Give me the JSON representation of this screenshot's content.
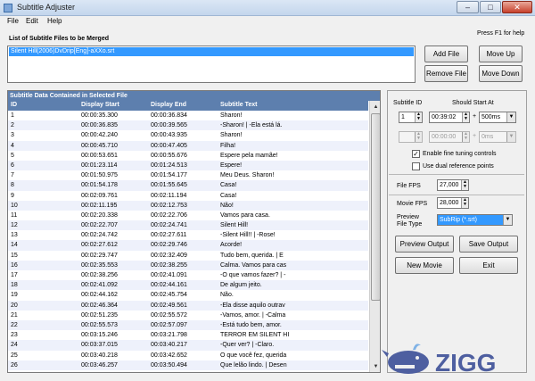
{
  "window": {
    "title": "Subtitle Adjuster",
    "minimize": "–",
    "maximize": "□",
    "close": "✕"
  },
  "menu": [
    "File",
    "Edit",
    "Help"
  ],
  "files": {
    "label": "List of Subtitle Files to be Merged",
    "help_hint": "Press F1 for help",
    "items": [
      "Silent Hill(2006)DvDrip[Eng]-aXXo.srt"
    ]
  },
  "buttons": {
    "add_file": "Add File",
    "move_up": "Move Up",
    "remove_file": "Remove File",
    "move_down": "Move Down",
    "preview_output": "Preview Output",
    "save_output": "Save Output",
    "new_movie": "New Movie",
    "exit": "Exit"
  },
  "grid": {
    "caption": "Subtitle Data Contained in Selected File",
    "columns": [
      "ID",
      "Display Start",
      "Display End",
      "Subtitle Text"
    ],
    "rows": [
      [
        "1",
        "00:00:35.300",
        "00:00:36.834",
        "Sharon!"
      ],
      [
        "2",
        "00:00:36.835",
        "00:00:39.565",
        "-Sharon! | -Ela está lá."
      ],
      [
        "3",
        "00:00:42.240",
        "00:00:43.935",
        "Sharon!"
      ],
      [
        "4",
        "00:00:45.710",
        "00:00:47.405",
        "Filha!"
      ],
      [
        "5",
        "00:00:53.651",
        "00:00:55.676",
        "Espere pela mamãe!"
      ],
      [
        "6",
        "00:01:23.114",
        "00:01:24.513",
        "Espere!"
      ],
      [
        "7",
        "00:01:50.975",
        "00:01:54.177",
        "Meu Deus. Sharon!"
      ],
      [
        "8",
        "00:01:54.178",
        "00:01:55.645",
        "Casa!"
      ],
      [
        "9",
        "00:02:09.761",
        "00:02:11.194",
        "Casa!"
      ],
      [
        "10",
        "00:02:11.195",
        "00:02:12.753",
        "Não!"
      ],
      [
        "11",
        "00:02:20.338",
        "00:02:22.706",
        "Vamos para casa."
      ],
      [
        "12",
        "00:02:22.707",
        "00:02:24.741",
        "Silent Hill!"
      ],
      [
        "13",
        "00:02:24.742",
        "00:02:27.611",
        "-Silent Hill!! | -Rose!"
      ],
      [
        "14",
        "00:02:27.612",
        "00:02:29.746",
        "Acorde!"
      ],
      [
        "15",
        "00:02:29.747",
        "00:02:32.409",
        "Tudo bem, querida. | E"
      ],
      [
        "16",
        "00:02:35.553",
        "00:02:38.255",
        "Calma. Vamos para cas"
      ],
      [
        "17",
        "00:02:38.256",
        "00:02:41.091",
        "-O que vamos fazer? | -"
      ],
      [
        "18",
        "00:02:41.092",
        "00:02:44.161",
        "De algum jeito."
      ],
      [
        "19",
        "00:02:44.162",
        "00:02:45.754",
        "Não."
      ],
      [
        "20",
        "00:02:46.364",
        "00:02:49.561",
        "-Ela disse aquilo outrav"
      ],
      [
        "21",
        "00:02:51.235",
        "00:02:55.572",
        "-Vamos, amor. | -Calma"
      ],
      [
        "22",
        "00:02:55.573",
        "00:02:57.097",
        "-Está tudo bem, amor."
      ],
      [
        "23",
        "00:03:15.246",
        "00:03:21.798",
        "TERROR EM SILENT HI"
      ],
      [
        "24",
        "00:03:37.015",
        "00:03:40.217",
        "-Quer ver? | -Claro."
      ],
      [
        "25",
        "00:03:40.218",
        "00:03:42.652",
        "O que você fez, querida"
      ],
      [
        "26",
        "00:03:46.257",
        "00:03:50.494",
        "Que lelão lindo. | Desen"
      ]
    ]
  },
  "panel": {
    "subtitle_id_label": "Subtitle ID",
    "should_start_label": "Should Start At",
    "subtitle_id": "1",
    "start_time": "00:39:02",
    "op1": "+",
    "offset1": "500ms",
    "subtitle_id2": "",
    "start_time2": "00:00:00",
    "op2": "+",
    "offset2": "0ms",
    "fine_tuning": {
      "label": "Enable fine tuning controls",
      "checked": true
    },
    "dual_reference": {
      "label": "Use dual reference points",
      "checked": false
    },
    "file_fps_label": "File FPS",
    "file_fps": "27,000",
    "movie_fps_label": "Movie FPS",
    "movie_fps": "28,000",
    "preview_type_label1": "Preview",
    "preview_type_label2": "File Type",
    "preview_type": "SubRip (*.srt)"
  },
  "logo": {
    "text": "ZIGG"
  },
  "colors": {
    "accent": "#5d7fae",
    "selection": "#3399ff",
    "logo": "#4e5fa0"
  }
}
